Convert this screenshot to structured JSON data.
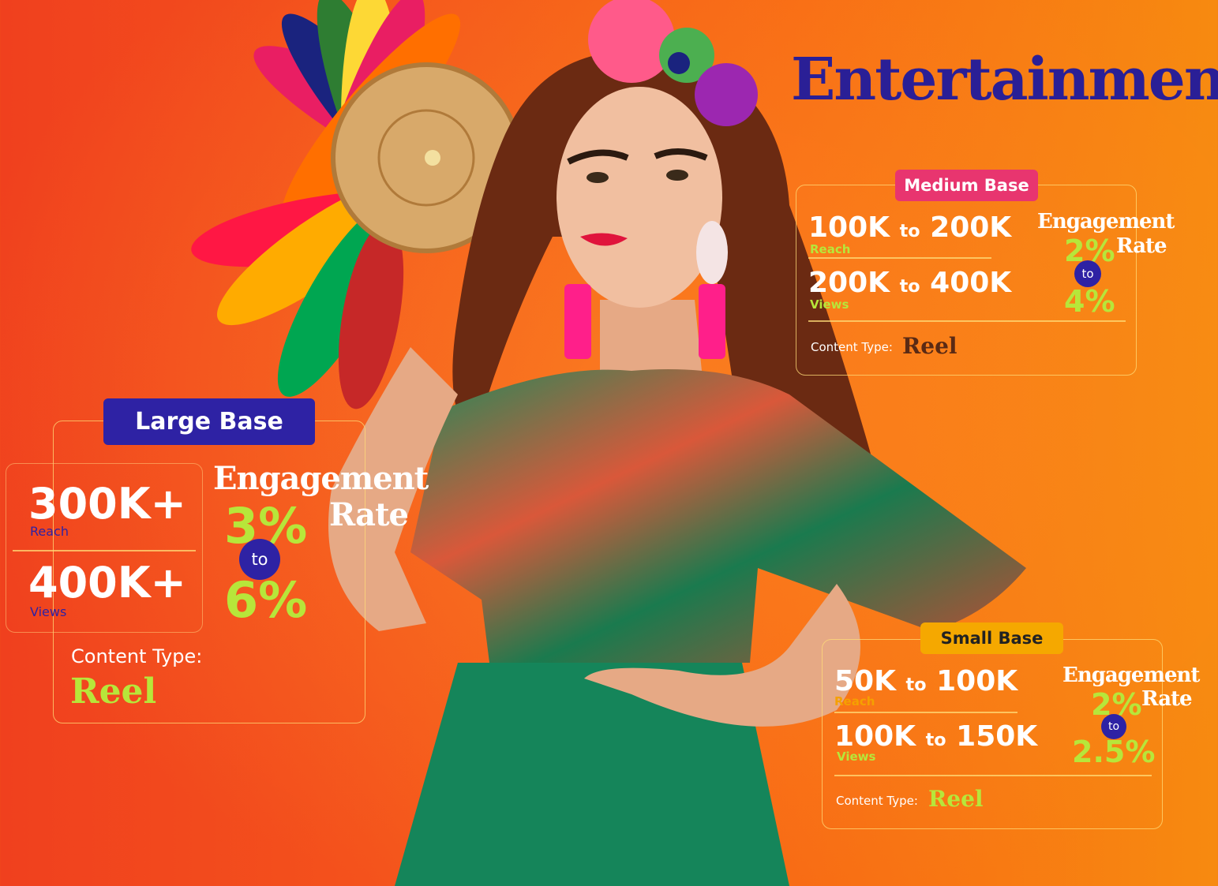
{
  "title": "Entertainment",
  "colors": {
    "title": "#2a1f96",
    "large_pill": "#2e22a4",
    "medium_pill": "#e8356f",
    "small_pill": "#f5a800",
    "percent": "#b7e63a",
    "reel_dark": "#5a2a14"
  },
  "medium": {
    "badge": "Medium Base",
    "reach_from": "100K",
    "reach_sep": "to",
    "reach_to": "200K",
    "reach_label": "Reach",
    "views_from": "200K",
    "views_sep": "to",
    "views_to": "400K",
    "views_label": "Views",
    "eng_line1": "Engagement",
    "eng_line2": "Rate",
    "rate_min": "2%",
    "rate_sep": "to",
    "rate_max": "4%",
    "content_label": "Content Type:",
    "content_value": "Reel"
  },
  "large": {
    "badge": "Large Base",
    "reach": "300K+",
    "reach_label": "Reach",
    "views": "400K+",
    "views_label": "Views",
    "eng_line1": "Engagement",
    "eng_line2": "Rate",
    "rate_min": "3%",
    "rate_sep": "to",
    "rate_max": "6%",
    "content_label": "Content Type:",
    "content_value": "Reel"
  },
  "small": {
    "badge": "Small Base",
    "reach_from": "50K",
    "reach_sep": "to",
    "reach_to": "100K",
    "reach_label": "Reach",
    "views_from": "100K",
    "views_sep": "to",
    "views_to": "150K",
    "views_label": "Views",
    "eng_line1": "Engagement",
    "eng_line2": "Rate",
    "rate_min": "2%",
    "rate_sep": "to",
    "rate_max": "2.5%",
    "content_label": "Content Type:",
    "content_value": "Reel"
  }
}
